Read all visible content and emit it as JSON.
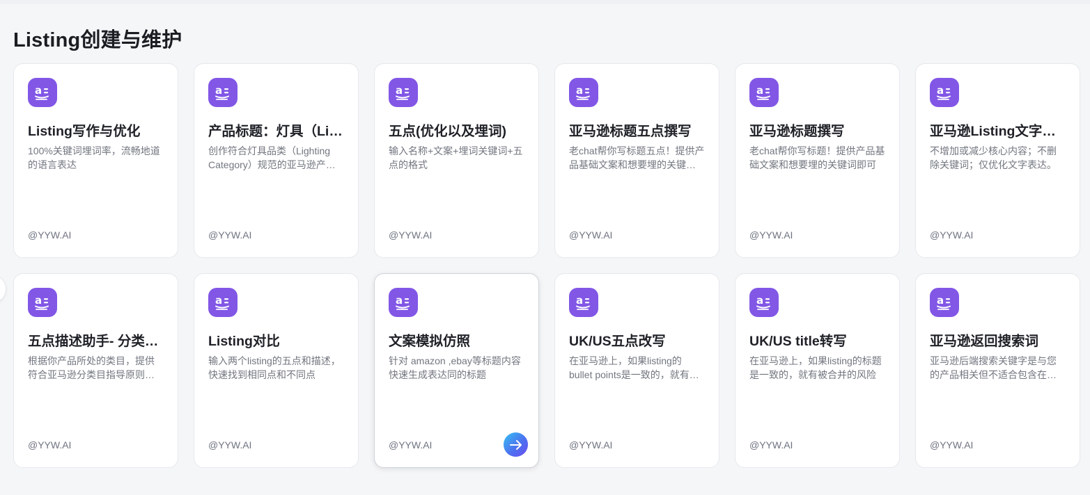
{
  "section": {
    "title": "Listing创建与维护"
  },
  "colors": {
    "icon_bg": "#8257e6",
    "page_bg": "#f5f6f8",
    "card_bg": "#ffffff"
  },
  "cards": [
    {
      "icon": "amazon-icon",
      "title": "Listing写作与优化",
      "desc": "100%关键词埋词率，流畅地道的语言表达",
      "author": "@YYW.AI"
    },
    {
      "icon": "amazon-icon",
      "title": "产品标题：灯具（Lighting Category）",
      "desc": "创作符合灯具品类（Lighting Category）规范的亚马逊产品标题",
      "author": "@YYW.AI"
    },
    {
      "icon": "amazon-icon",
      "title": "五点(优化以及埋词)",
      "desc": "输入名称+文案+埋词关键词+五点的格式",
      "author": "@YYW.AI"
    },
    {
      "icon": "amazon-icon",
      "title": "亚马逊标题五点撰写",
      "desc": "老chat帮你写标题五点！提供产品基础文案和想要埋的关键词即可",
      "author": "@YYW.AI"
    },
    {
      "icon": "amazon-icon",
      "title": "亚马逊标题撰写",
      "desc": "老chat帮你写标题！提供产品基础文案和想要埋的关键词即可",
      "author": "@YYW.AI"
    },
    {
      "icon": "amazon-icon",
      "title": "亚马逊Listing文字优化",
      "desc": "不增加或减少核心内容；不删除关键词；仅优化文字表达。",
      "author": "@YYW.AI"
    },
    {
      "icon": "amazon-icon",
      "title": "五点描述助手- 分类指导",
      "desc": "根据你产品所处的类目，提供符合亚马逊分类目指导原则的五点描述",
      "author": "@YYW.AI"
    },
    {
      "icon": "amazon-icon",
      "title": "Listing对比",
      "desc": "输入两个listing的五点和描述，快速找到相同点和不同点",
      "author": "@YYW.AI"
    },
    {
      "icon": "amazon-icon",
      "title": "文案模拟仿照",
      "desc": "针对 amazon ,ebay等标题内容快速生成表达同的标题",
      "author": "@YYW.AI",
      "hovered": true
    },
    {
      "icon": "amazon-icon",
      "title": "UK/US五点改写",
      "desc": "在亚马逊上，如果listing的bullet points是一致的，就有被合并的风险",
      "author": "@YYW.AI"
    },
    {
      "icon": "amazon-icon",
      "title": "UK/US title转写",
      "desc": "在亚马逊上，如果listing的标题是一致的，就有被合并的风险",
      "author": "@YYW.AI"
    },
    {
      "icon": "amazon-icon",
      "title": "亚马逊返回搜索词",
      "desc": "亚马逊后端搜索关键字是与您的产品相关但不适合包含在标题中的词",
      "author": "@YYW.AI"
    }
  ],
  "go_button_icon": "arrow-right-icon"
}
